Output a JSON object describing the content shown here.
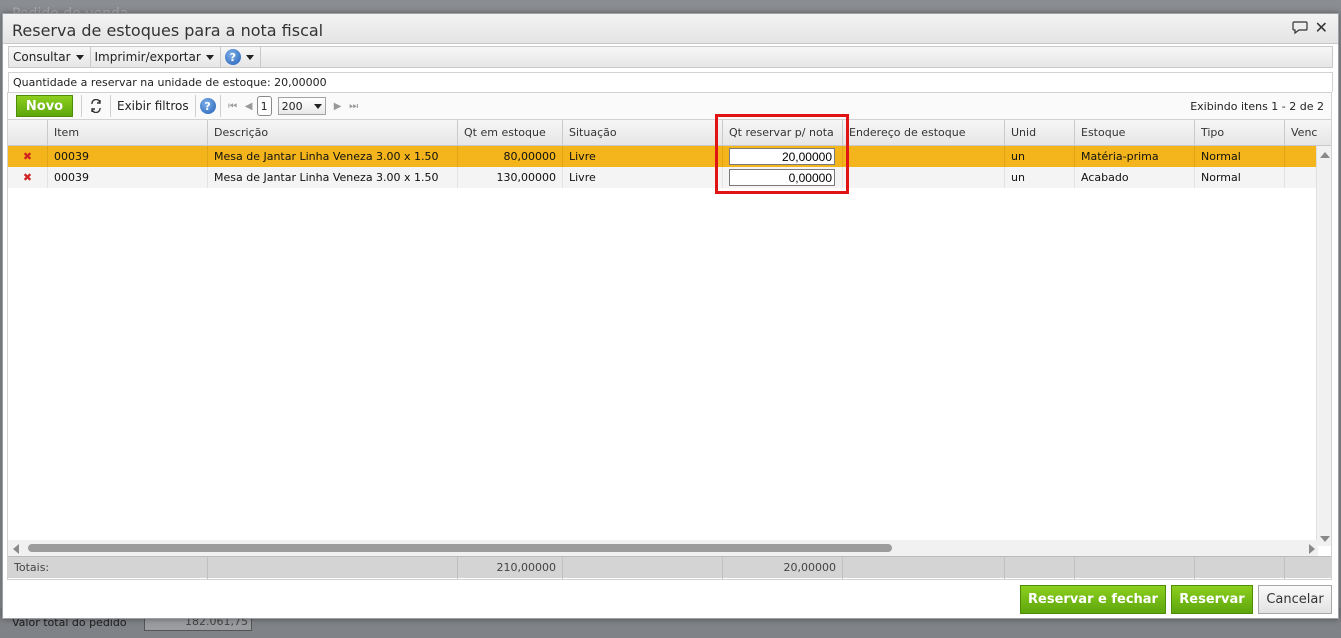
{
  "background": {
    "title": "Pedido de venda",
    "total_label": "Valor total do pedido",
    "total_value": "182.061,75"
  },
  "dialog": {
    "title": "Reserva de estoques para a nota fiscal",
    "menu": {
      "consultar": "Consultar",
      "imprimir": "Imprimir/exportar"
    },
    "info": "Quantidade a reservar na unidade de estoque: 20,00000",
    "toolbar": {
      "novo": "Novo",
      "exibir_filtros": "Exibir filtros",
      "page": "1",
      "page_size": "200",
      "range_text": "Exibindo itens 1 - 2 de 2"
    },
    "columns": {
      "item": "Item",
      "descricao": "Descrição",
      "qt_estoque": "Qt em estoque",
      "situacao": "Situação",
      "qt_reservar": "Qt reservar p/ nota",
      "endereco": "Endereço de estoque",
      "unid": "Unid",
      "estoque": "Estoque",
      "tipo": "Tipo",
      "venc": "Venc"
    },
    "rows": [
      {
        "item": "00039",
        "descricao": "Mesa de Jantar Linha Veneza 3.00 x 1.50",
        "qt_estoque": "80,00000",
        "situacao": "Livre",
        "qt_reservar": "20,00000",
        "endereco": "",
        "unid": "un",
        "estoque": "Matéria-prima",
        "tipo": "Normal"
      },
      {
        "item": "00039",
        "descricao": "Mesa de Jantar Linha Veneza 3.00 x 1.50",
        "qt_estoque": "130,00000",
        "situacao": "Livre",
        "qt_reservar": "0,00000",
        "endereco": "",
        "unid": "un",
        "estoque": "Acabado",
        "tipo": "Normal"
      }
    ],
    "totals": {
      "label": "Totais:",
      "qt_estoque": "210,00000",
      "qt_reservar": "20,00000"
    },
    "buttons": {
      "reservar_fechar": "Reservar e fechar",
      "reservar": "Reservar",
      "cancelar": "Cancelar"
    },
    "colors": {
      "selected_row": "#f3b51b",
      "primary_button": "#6cb514",
      "highlight": "#e11414"
    }
  }
}
